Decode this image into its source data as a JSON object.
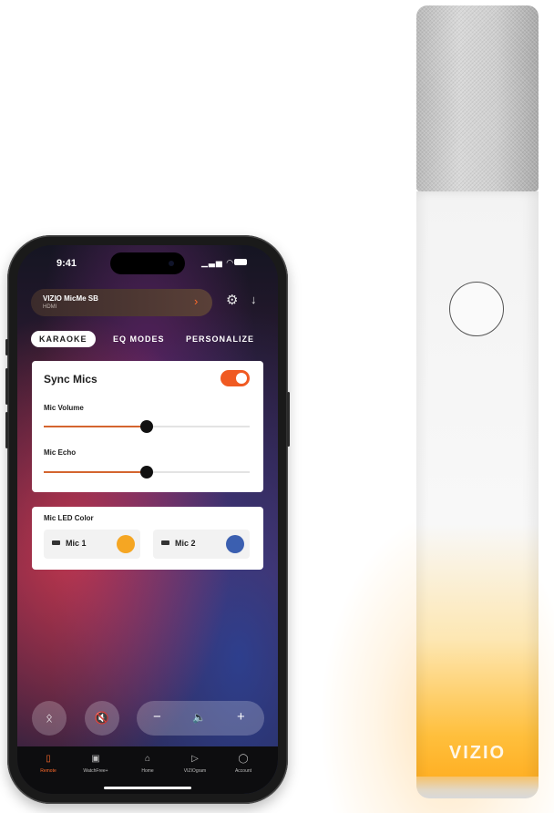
{
  "microphone": {
    "brand": "VIZIO",
    "glow_color": "#ffae2b"
  },
  "phone": {
    "status_bar": {
      "time": "9:41",
      "signal_icons": "▁▃▅ ◠"
    },
    "header": {
      "device_name": "VIZIO MicMe SB",
      "device_input": "HDMI",
      "chevron_icon": "chevron-right-icon",
      "settings_icon": "gear-icon",
      "download_icon": "download-icon"
    },
    "tabs": [
      {
        "label": "KARAOKE",
        "active": true
      },
      {
        "label": "EQ MODES",
        "active": false
      },
      {
        "label": "PERSONALIZE",
        "active": false
      }
    ],
    "karaoke": {
      "sync_mics_label": "Sync Mics",
      "sync_mics_on": true,
      "mic_volume": {
        "label": "Mic Volume",
        "value_fraction": 0.5
      },
      "mic_echo": {
        "label": "Mic Echo",
        "value_fraction": 0.5
      }
    },
    "led_color": {
      "title": "Mic LED Color",
      "mics": [
        {
          "label": "Mic 1",
          "color": "#f5a623"
        },
        {
          "label": "Mic 2",
          "color": "#3b5fb0"
        }
      ]
    },
    "controls": {
      "bluetooth_icon": "bluetooth-icon",
      "mute_icon": "mute-icon",
      "volume_down": "−",
      "volume_icon": "volume-icon",
      "volume_up": "+"
    },
    "bottom_nav": [
      {
        "label": "Remote",
        "icon": "remote-icon",
        "active": true
      },
      {
        "label": "WatchFree+",
        "icon": "tv-icon",
        "active": false
      },
      {
        "label": "Home",
        "icon": "home-icon",
        "active": false
      },
      {
        "label": "VIZIOgram",
        "icon": "play-icon",
        "active": false
      },
      {
        "label": "Account",
        "icon": "account-icon",
        "active": false
      }
    ],
    "accent_color": "#f05a22"
  }
}
